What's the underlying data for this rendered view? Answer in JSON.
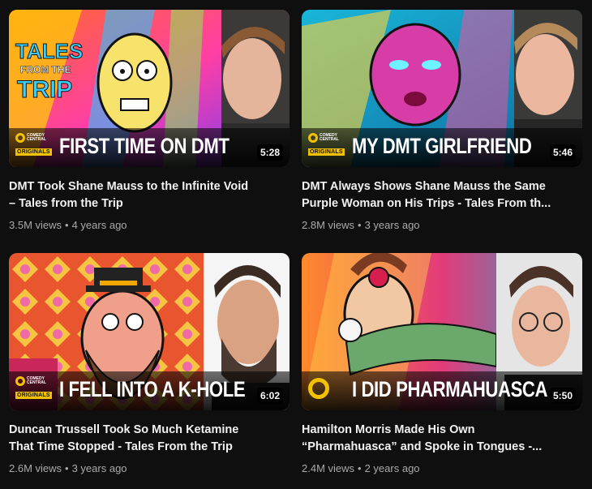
{
  "videos": [
    {
      "headline": "FIRST TIME ON DMT",
      "duration": "5:28",
      "title_line1": "DMT Took Shane Mauss to the Infinite Void",
      "title_line2": "– Tales from the Trip",
      "views": "3.5M views",
      "age": "4 years ago",
      "thumb_text": [
        "TALES",
        "FROM THE",
        "TRIP"
      ]
    },
    {
      "headline": "MY DMT GIRLFRIEND",
      "duration": "5:46",
      "title_line1": "DMT Always Shows Shane Mauss the Same",
      "title_line2": "Purple Woman on His Trips - Tales From th...",
      "views": "2.8M views",
      "age": "3 years ago"
    },
    {
      "headline": "I FELL INTO A K-HOLE",
      "duration": "6:02",
      "title_line1": "Duncan Trussell Took So Much Ketamine",
      "title_line2": "That Time Stopped - Tales From the Trip",
      "views": "2.6M views",
      "age": "3 years ago"
    },
    {
      "headline": "I DID PHARMAHUASCA",
      "duration": "5:50",
      "title_line1": "Hamilton Morris Made His Own",
      "title_line2": "“Pharmahuasca” and Spoke in Tongues -...",
      "views": "2.4M views",
      "age": "2 years ago"
    }
  ],
  "brand": {
    "logo_line1": "COMEDY",
    "logo_line2": "CENTRAL",
    "logo_badge": "ORIGINALS",
    "accent": "#f2c200"
  },
  "meta_separator": "•"
}
